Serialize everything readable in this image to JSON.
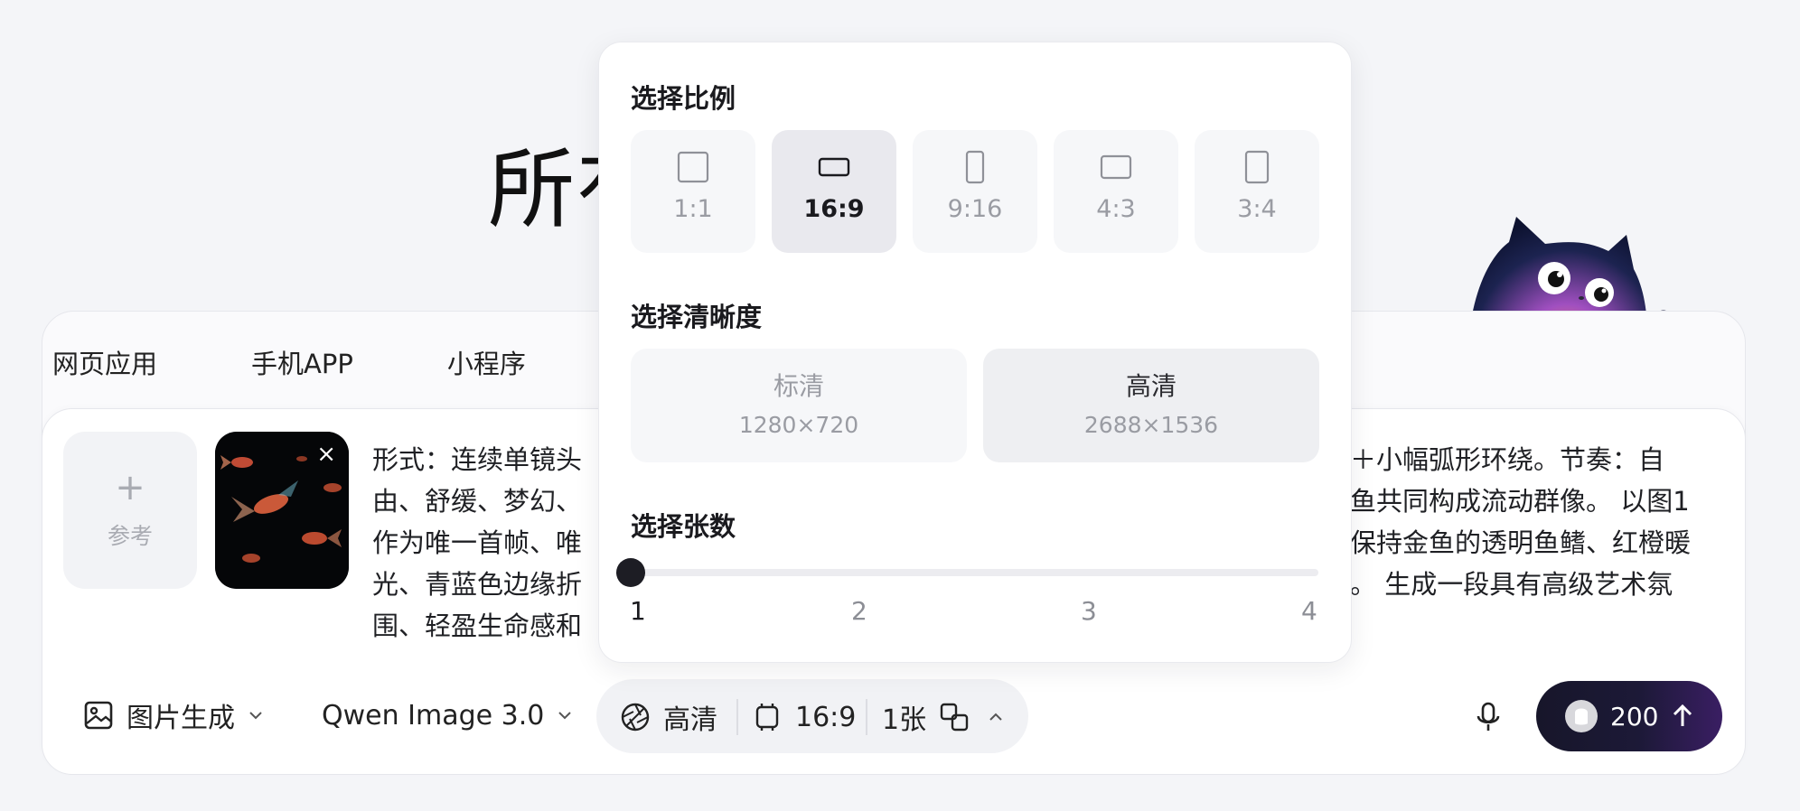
{
  "headline": "所有",
  "top_tabs": [
    "网页应用",
    "手机APP",
    "小程序"
  ],
  "reference": {
    "plus": "+",
    "label": "参考"
  },
  "thumbnail_close": "×",
  "prompt_lines": [
    "形式：连续单镜头",
    "由、舒缓、梦幻、",
    "作为唯一首帧、唯",
    "光、青蓝色边缘折",
    "围、轻盈生命感和"
  ],
  "prompt_lines_right": [
    "＋小幅弧形环绕。节奏：自",
    "鱼共同构成流动群像。 以图1",
    "保持金鱼的透明鱼鳍、红橙暖",
    "。 生成一段具有高级艺术氛"
  ],
  "toolbar": {
    "mode_label": "图片生成",
    "model_label": "Qwen Image 3.0",
    "quality_label": "高清",
    "ratio_label": "16:9",
    "count_label": "1张",
    "send_cost": "200"
  },
  "popover": {
    "ratio_title": "选择比例",
    "ratios": [
      {
        "label": "1:1",
        "icon": "square-icon"
      },
      {
        "label": "16:9",
        "icon": "wide-rect-icon"
      },
      {
        "label": "9:16",
        "icon": "tall-rect-icon"
      },
      {
        "label": "4:3",
        "icon": "landscape-rect-icon"
      },
      {
        "label": "3:4",
        "icon": "portrait-rect-icon"
      }
    ],
    "ratio_selected": "16:9",
    "resolution_title": "选择清晰度",
    "resolutions": [
      {
        "name": "标清",
        "size": "1280×720"
      },
      {
        "name": "高清",
        "size": "2688×1536"
      }
    ],
    "resolution_selected": "高清",
    "count_title": "选择张数",
    "count_ticks": [
      "1",
      "2",
      "3",
      "4"
    ],
    "count_value": 1
  },
  "colors": {
    "send_gradient_start": "#17162a",
    "send_gradient_end": "#3a1e63",
    "selected_card": "#e9e9ee",
    "slider_thumb": "#1d1d24"
  }
}
